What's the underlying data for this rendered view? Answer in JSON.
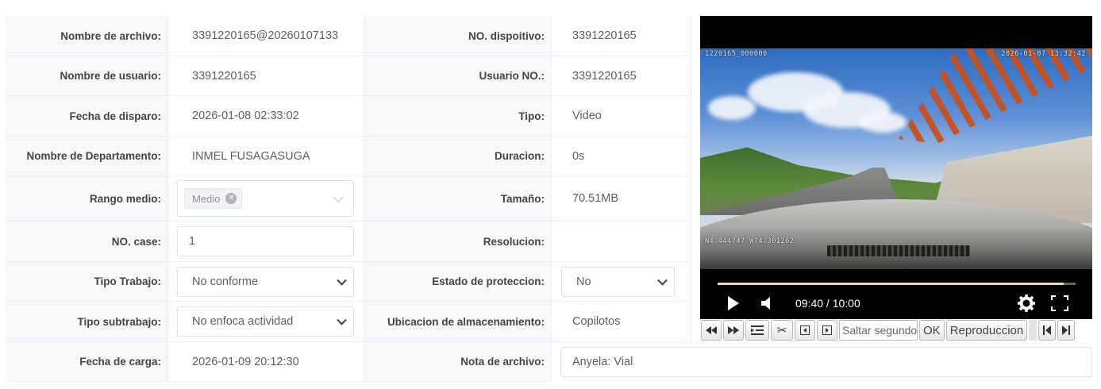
{
  "fields": {
    "nombre_archivo": {
      "label": "Nombre de archivo",
      "value": "3391220165@20260107133"
    },
    "no_dispositivo": {
      "label": "NO. dispoitivo",
      "value": "3391220165"
    },
    "nombre_usuario": {
      "label": "Nombre de usuario",
      "value": "3391220165"
    },
    "usuario_no": {
      "label": "Usuario NO.",
      "value": "3391220165"
    },
    "fecha_disparo": {
      "label": "Fecha de disparo",
      "value": "2026-01-08 02:33:02"
    },
    "tipo": {
      "label": "Tipo",
      "value": "Video"
    },
    "departamento": {
      "label": "Nombre de Departamento",
      "value": "INMEL FUSAGASUGA"
    },
    "duracion": {
      "label": "Duracion",
      "value": "0s"
    },
    "rango_medio": {
      "label": "Rango medio",
      "tag": "Medio"
    },
    "tamano": {
      "label": "Tamaño",
      "value": "70.51MB"
    },
    "no_case": {
      "label": "NO. case",
      "value": "1"
    },
    "resolucion": {
      "label": "Resolucion",
      "value": ""
    },
    "tipo_trabajo": {
      "label": "Tipo Trabajo",
      "value": "No conforme"
    },
    "estado_proteccion": {
      "label": "Estado de proteccion",
      "value": "No"
    },
    "tipo_subtrabajo": {
      "label": "Tipo subtrabajo",
      "value": "No enfoca actividad"
    },
    "ubicacion": {
      "label": "Ubicacion de almacenamiento",
      "value": "Copilotos"
    },
    "fecha_carga": {
      "label": "Fecha de carga",
      "value": "2026-01-09 20:12:30"
    },
    "nota_archivo": {
      "label": "Nota de archivo",
      "value": "Anyela: Vial"
    }
  },
  "label_suffix": ":",
  "video": {
    "osd_id": "1220165_000000",
    "osd_datetime": "2026-01-07  13:32:42",
    "osd_gps": "N4.444747  W74.301262",
    "time_display": "09:40 / 10:00",
    "progress": 0.967
  },
  "toolbar": {
    "seek_placeholder": "Saltar segundo",
    "ok_label": "OK",
    "playback_label": "Reproduccion"
  }
}
